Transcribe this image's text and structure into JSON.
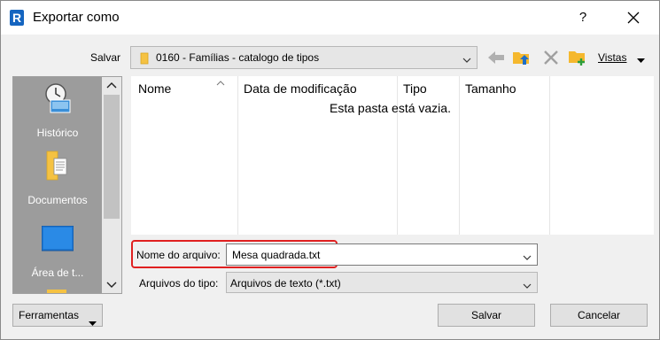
{
  "window": {
    "title": "Exportar como",
    "help_label": "?",
    "app_icon_letter": "R"
  },
  "location": {
    "label": "Salvar",
    "current_folder": "0160 - Famílias - catalogo de tipos"
  },
  "toolbar": {
    "back_icon": "back-arrow-icon",
    "up_folder_icon": "up-one-level-icon",
    "delete_icon": "delete-icon",
    "new_folder_icon": "new-folder-icon",
    "views_label": "Vistas"
  },
  "places": [
    {
      "label": "Histórico",
      "icon": "history-icon"
    },
    {
      "label": "Documentos",
      "icon": "documents-icon"
    },
    {
      "label": "Área de t...",
      "icon": "desktop-icon"
    }
  ],
  "filelist": {
    "columns": [
      "Nome",
      "Data de modificação",
      "Tipo",
      "Tamanho"
    ],
    "empty_message": "Esta pasta está vazia."
  },
  "form": {
    "filename_label": "Nome do arquivo:",
    "filename_value": "Mesa quadrada.txt",
    "filetype_label": "Arquivos do tipo:",
    "filetype_value": "Arquivos de texto  (*.txt)"
  },
  "buttons": {
    "tools": "Ferramentas",
    "save": "Salvar",
    "cancel": "Cancelar"
  },
  "colors": {
    "highlight_border": "#e02020",
    "folder_yellow": "#f5c242",
    "places_bg": "#9c9c9c",
    "desktop_blue": "#1e78d4"
  }
}
